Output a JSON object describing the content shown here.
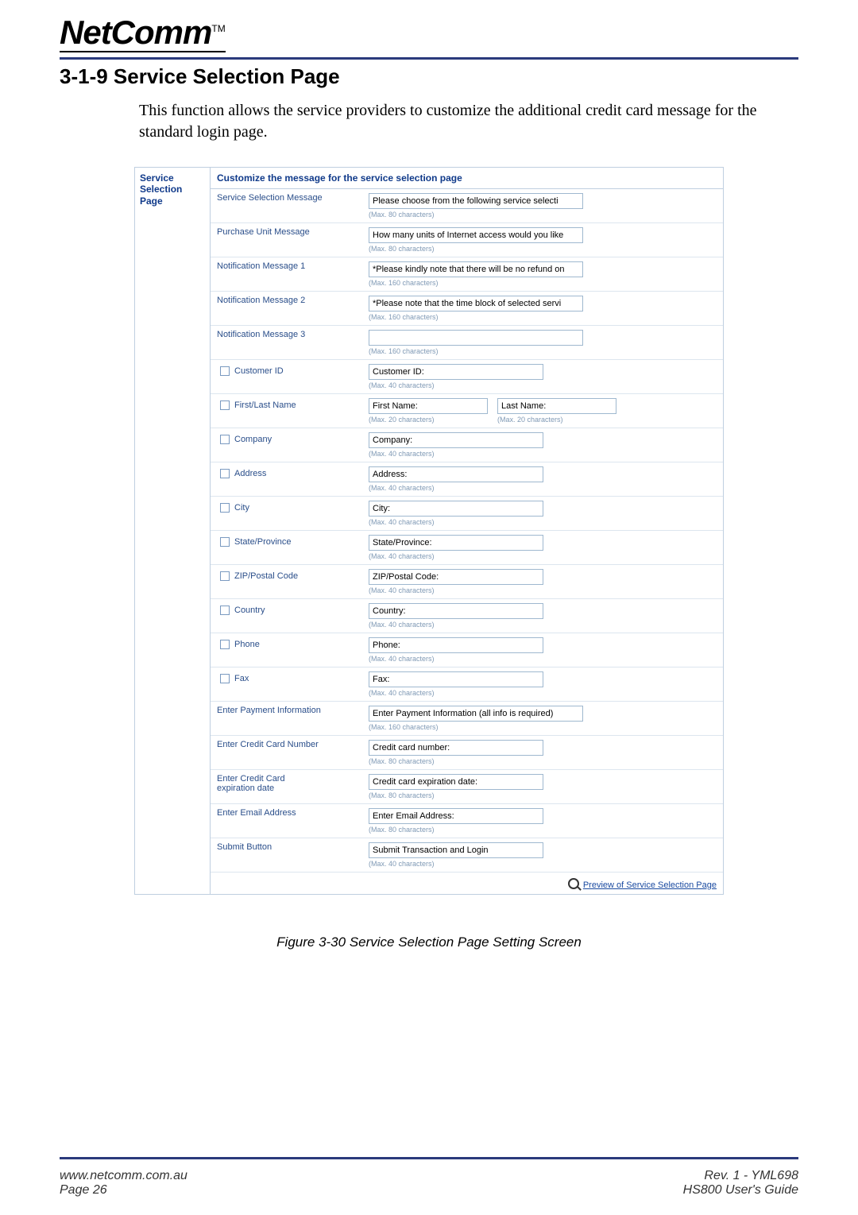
{
  "logo": {
    "brand": "NetComm",
    "tm": "TM"
  },
  "section_title": "3-1-9  Service Selection Page",
  "intro": "This function allows the service providers to customize the additional credit card message for the standard login page.",
  "panel": {
    "left_title_l1": "Service",
    "left_title_l2": "Selection Page",
    "header": "Customize the message for the service selection page",
    "rows": {
      "svc_sel_msg": {
        "label": "Service Selection Message",
        "value": "Please choose from the following service selecti",
        "hint": "(Max. 80 characters)"
      },
      "purchase_unit": {
        "label": "Purchase Unit Message",
        "value": "How many units of Internet access would you like",
        "hint": "(Max. 80 characters)"
      },
      "notif1": {
        "label": "Notification Message 1",
        "value": "*Please kindly note that there will be no refund on",
        "hint": "(Max. 160 characters)"
      },
      "notif2": {
        "label": "Notification Message 2",
        "value": "*Please note that the time block of selected servi",
        "hint": "(Max. 160 characters)"
      },
      "notif3": {
        "label": "Notification Message 3",
        "value": "",
        "hint": "(Max. 160 characters)"
      },
      "customer_id": {
        "label": "Customer ID",
        "value": "Customer ID:",
        "hint": "(Max. 40 characters)"
      },
      "first_last": {
        "label": "First/Last Name",
        "first": "First Name:",
        "last": "Last Name:",
        "hint1": "(Max. 20 characters)",
        "hint2": "(Max. 20 characters)"
      },
      "company": {
        "label": "Company",
        "value": "Company:",
        "hint": "(Max. 40 characters)"
      },
      "address": {
        "label": "Address",
        "value": "Address:",
        "hint": "(Max. 40 characters)"
      },
      "city": {
        "label": "City",
        "value": "City:",
        "hint": "(Max. 40 characters)"
      },
      "state": {
        "label": "State/Province",
        "value": "State/Province:",
        "hint": "(Max. 40 characters)"
      },
      "zip": {
        "label": "ZIP/Postal Code",
        "value": "ZIP/Postal Code:",
        "hint": "(Max. 40 characters)"
      },
      "country": {
        "label": "Country",
        "value": "Country:",
        "hint": "(Max. 40 characters)"
      },
      "phone": {
        "label": "Phone",
        "value": "Phone:",
        "hint": "(Max. 40 characters)"
      },
      "fax": {
        "label": "Fax",
        "value": "Fax:",
        "hint": "(Max. 40 characters)"
      },
      "enter_payment": {
        "label": "Enter Payment Information",
        "value": "Enter Payment Information (all info is required)",
        "hint": "(Max. 160 characters)"
      },
      "cc_number": {
        "label": "Enter Credit Card Number",
        "value": "Credit card number:",
        "hint": "(Max. 80 characters)"
      },
      "cc_exp": {
        "label_l1": "Enter Credit Card",
        "label_l2": "expiration date",
        "value": "Credit card expiration date:",
        "hint": "(Max. 80 characters)"
      },
      "email": {
        "label": "Enter Email Address",
        "value": "Enter Email Address:",
        "hint": "(Max. 80 characters)"
      },
      "submit": {
        "label": "Submit Button",
        "value": "Submit Transaction and Login",
        "hint": "(Max. 40 characters)"
      }
    },
    "preview_link": "Preview of Service Selection Page"
  },
  "caption": "Figure 3-30 Service Selection Page Setting Screen",
  "footer": {
    "left_l1": "www.netcomm.com.au",
    "left_l2": "Page 26",
    "right_l1": "Rev. 1 - YML698",
    "right_l2": "HS800 User's Guide"
  }
}
